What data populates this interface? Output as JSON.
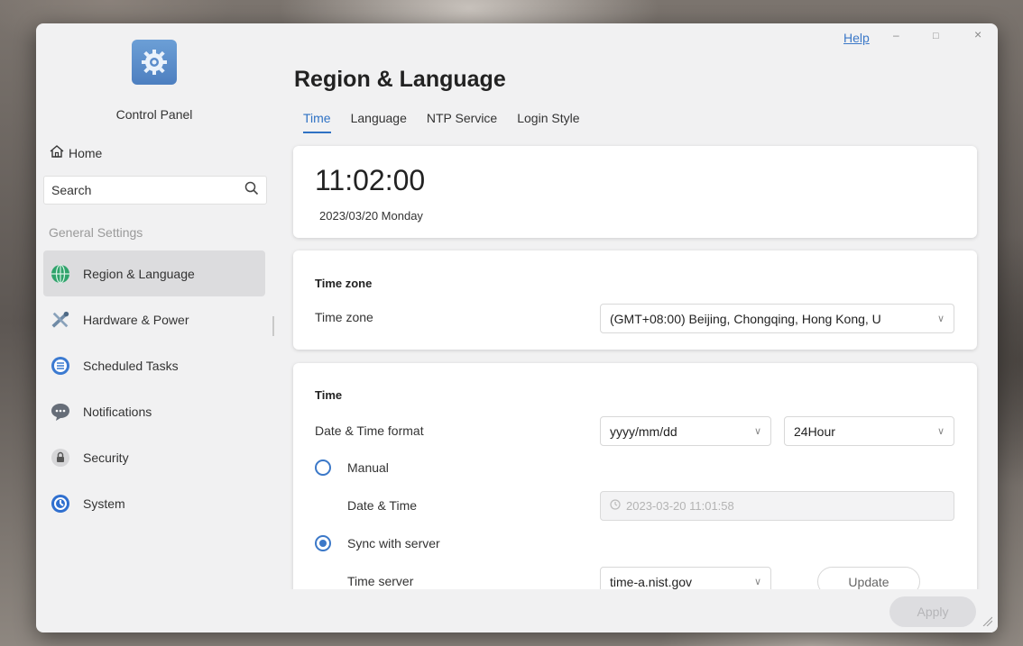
{
  "window": {
    "help_label": "Help",
    "minimize_label": "–",
    "maximize_label": "□",
    "close_label": "×"
  },
  "sidebar": {
    "app_title": "Control Panel",
    "home_label": "Home",
    "search_placeholder": "Search",
    "section_label": "General Settings",
    "items": [
      {
        "label": "Region & Language",
        "icon": "globe-icon",
        "active": true
      },
      {
        "label": "Hardware & Power",
        "icon": "tools-icon",
        "active": false
      },
      {
        "label": "Scheduled Tasks",
        "icon": "tasks-icon",
        "active": false
      },
      {
        "label": "Notifications",
        "icon": "chat-bubble-icon",
        "active": false
      },
      {
        "label": "Security",
        "icon": "lock-icon",
        "active": false
      },
      {
        "label": "System",
        "icon": "system-icon",
        "active": false
      }
    ]
  },
  "main": {
    "title": "Region & Language",
    "tabs": [
      {
        "label": "Time",
        "active": true
      },
      {
        "label": "Language",
        "active": false
      },
      {
        "label": "NTP Service",
        "active": false
      },
      {
        "label": "Login Style",
        "active": false
      }
    ],
    "clock": {
      "time": "11:02:00",
      "date": "2023/03/20 Monday"
    },
    "timezone_card": {
      "heading": "Time zone",
      "label": "Time zone",
      "value": "(GMT+08:00) Beijing, Chongqing, Hong Kong, U"
    },
    "time_card": {
      "heading": "Time",
      "format_label": "Date & Time format",
      "date_format": "yyyy/mm/dd",
      "hour_format": "24Hour",
      "manual_label": "Manual",
      "datetime_label": "Date & Time",
      "datetime_value": "2023-03-20 11:01:58",
      "sync_label": "Sync with server",
      "server_label": "Time server",
      "server_value": "time-a.nist.gov",
      "update_label": "Update",
      "mode": "sync"
    },
    "apply_label": "Apply"
  },
  "colors": {
    "accent": "#2f72c4",
    "sidebar_active": "#dcdcde",
    "window_bg": "#f1f1f2"
  }
}
